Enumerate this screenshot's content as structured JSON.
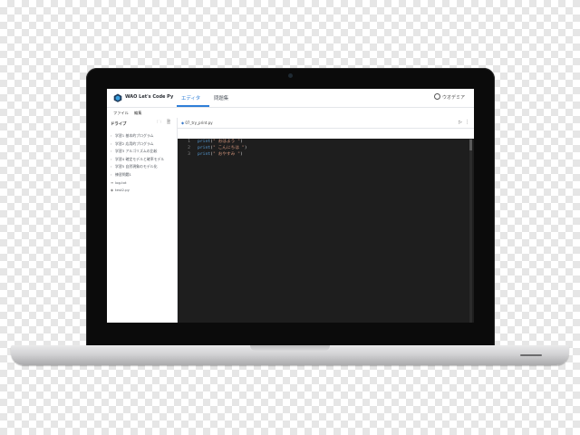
{
  "app": {
    "title": "WAO Let's Code Py",
    "tabs": [
      {
        "label": "エディタ",
        "active": true
      },
      {
        "label": "問題集",
        "active": false
      }
    ],
    "user": "ウオデミア"
  },
  "menu": {
    "items": [
      "ファイル",
      "編集"
    ]
  },
  "sidebar": {
    "heading": "ドライブ",
    "items": [
      {
        "label": "学習1 基本的プログラム",
        "type": "folder"
      },
      {
        "label": "学習2 応用的プログラム",
        "type": "folder"
      },
      {
        "label": "学習3 アルゴリズムの比較",
        "type": "folder"
      },
      {
        "label": "学習4 確定モデルと確率モデル",
        "type": "folder"
      },
      {
        "label": "学習5 自然現象のモデル化",
        "type": "folder"
      },
      {
        "label": "練習問題1",
        "type": "folder"
      },
      {
        "label": "log.txt",
        "type": "file"
      },
      {
        "label": "test2.py",
        "type": "file"
      }
    ]
  },
  "editor": {
    "open_tab": "07_try_print.py",
    "breadcrumb": [
      "学習1 基本的プログラム",
      "07_try_print.py"
    ],
    "lines": [
      {
        "num": "1",
        "fn": "print",
        "arg": "\" おはよう \""
      },
      {
        "num": "2",
        "fn": "print",
        "arg": "\" こんにちは \""
      },
      {
        "num": "3",
        "fn": "print",
        "arg": "\" おやすみ \""
      }
    ]
  },
  "colors": {
    "accent": "#2f7fd8",
    "editor_bg": "#1e1e1e",
    "keyword": "#569cd6",
    "string": "#ce9178"
  }
}
